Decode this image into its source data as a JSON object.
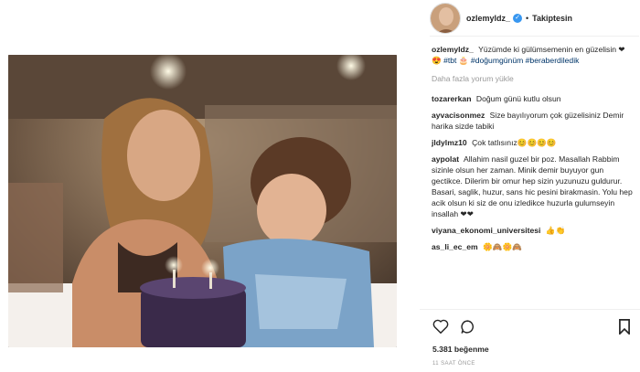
{
  "post": {
    "username": "ozlemyldz_",
    "follow_label": "Takiptesin",
    "separator": "•",
    "caption_text": "Yüzümde ki gülümsemenin en güzelisin ❤😍",
    "hashtags": [
      "#tbt",
      "🎂",
      "#doğumgünüm",
      "#beraberdiledik"
    ],
    "load_more": "Daha fazla yorum yükle"
  },
  "comments": [
    {
      "user": "tozarerkan",
      "text": "Doğum günü kutlu olsun"
    },
    {
      "user": "ayvacisonmez",
      "text": "Size bayılıyorum çok güzelisiniz Demir harika sizde tabiki"
    },
    {
      "user": "jldylmz10",
      "text": "Çok tatlısınız😊😊😊😊"
    },
    {
      "user": "aypolat",
      "text": "Allahim nasil guzel bir poz. Masallah Rabbim sizinle olsun her zaman. Minik demir buyuyor gun gectikce. Dilerim bir omur hep sizin yuzunuzu guldurur. Basari, saglik, huzur, sans hic pesini birakmasin. Yolu hep acik olsun ki siz de onu izledikce huzurla gulumseyin insallah ❤❤"
    },
    {
      "user": "viyana_ekonomi_universitesi",
      "text": "👍👏"
    },
    {
      "user": "as_li_ec_em",
      "text": "🌼🙈🌼🙈"
    }
  ],
  "footer": {
    "likes": "5.381 beğenme",
    "time": "11 SAAT ÖNCE"
  },
  "icons": {
    "like": "heart-outline-icon",
    "comment": "comment-bubble-icon",
    "save": "bookmark-icon",
    "verified": "verified-badge-icon"
  },
  "colors": {
    "verified_blue": "#3897f0",
    "heart_red": "#ed4956",
    "link_blue": "#003569"
  }
}
